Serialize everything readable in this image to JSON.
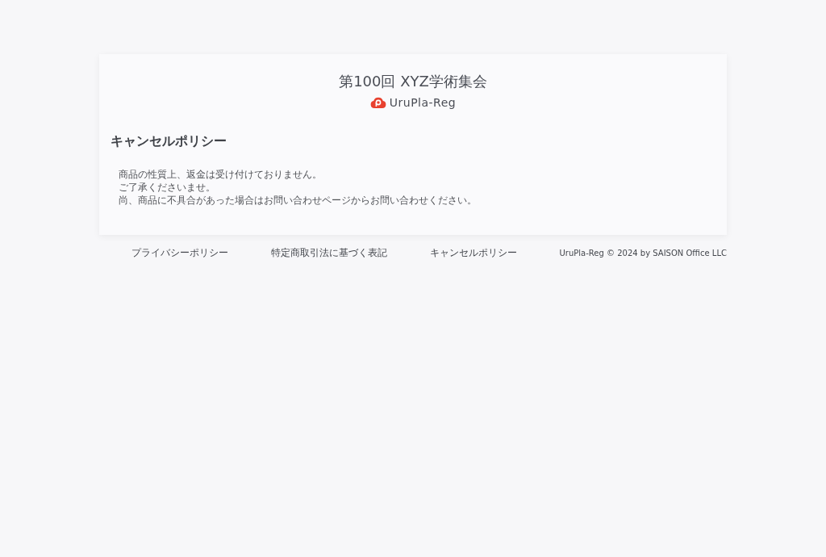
{
  "header": {
    "event_title": "第100回 XYZ学術集会",
    "brand": "UruPla-Reg"
  },
  "page_title": "キャンセルポリシー",
  "body_lines": [
    "商品の性質上、返金は受け付けておりません。",
    "ご了承くださいませ。",
    "尚、商品に不具合があった場合はお問い合わせページからお問い合わせください。"
  ],
  "footer": {
    "links": [
      "プライバシーポリシー",
      "特定商取引法に基づく表記",
      "キャンセルポリシー"
    ],
    "copyright": "UruPla-Reg © 2024 by SAISON Office LLC"
  }
}
